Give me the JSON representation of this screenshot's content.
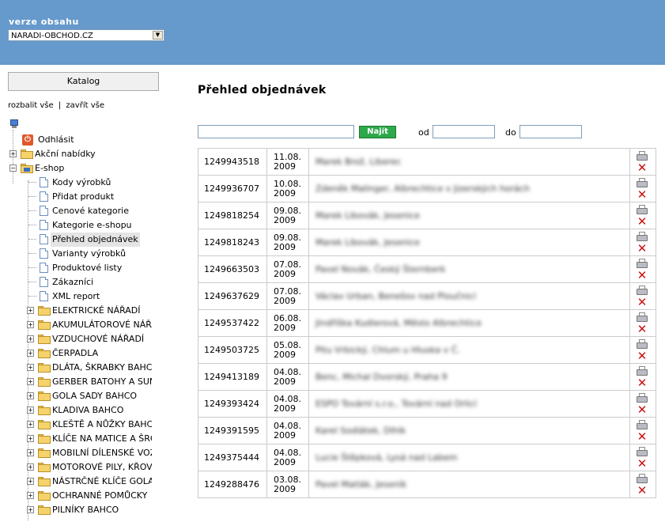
{
  "header": {
    "version_label": "verze obsahu",
    "version_selected": "NARADI-OBCHOD.CZ"
  },
  "sidebar": {
    "katalog_button": "Katalog",
    "expand_all": "rozbalit vše",
    "separator": "|",
    "collapse_all": "zavřít vše",
    "tree": [
      {
        "label": "Odhlásit",
        "icon": "logout-icon"
      },
      {
        "label": "Akční nabídky",
        "icon": "folder-icon"
      },
      {
        "label": "E-shop",
        "icon": "folder-open-icon"
      },
      {
        "label": "Kody výrobků",
        "icon": "page-icon"
      },
      {
        "label": "Přidat produkt",
        "icon": "page-icon"
      },
      {
        "label": "Cenové kategorie",
        "icon": "page-icon"
      },
      {
        "label": "Kategorie e-shopu",
        "icon": "page-icon"
      },
      {
        "label": "Přehled objednávek",
        "icon": "page-icon"
      },
      {
        "label": "Varianty výrobků",
        "icon": "page-icon"
      },
      {
        "label": "Produktové listy",
        "icon": "page-icon"
      },
      {
        "label": "Zákazníci",
        "icon": "page-icon"
      },
      {
        "label": "XML report",
        "icon": "page-icon"
      },
      {
        "label": "ELEKTRICKÉ NÁŘADÍ",
        "icon": "folder-icon"
      },
      {
        "label": "AKUMULÁTOROVÉ NÁŘADÍ",
        "icon": "folder-icon"
      },
      {
        "label": "VZDUCHOVÉ NÁŘADÍ",
        "icon": "folder-icon"
      },
      {
        "label": "ČERPADLA",
        "icon": "folder-icon"
      },
      {
        "label": "DLÁTA, ŠKRABKY BAHCO",
        "icon": "folder-icon"
      },
      {
        "label": "GERBER BATOHY A SUMKY",
        "icon": "folder-icon"
      },
      {
        "label": "GOLA SADY BAHCO",
        "icon": "folder-icon"
      },
      {
        "label": "KLADIVA BAHCO",
        "icon": "folder-icon"
      },
      {
        "label": "KLEŠTĚ A NŮŽKY BAHCO",
        "icon": "folder-icon"
      },
      {
        "label": "KLÍČE NA MATICE A ŠROUBY",
        "icon": "folder-icon"
      },
      {
        "label": "MOBILNÍ DÍLENSKÉ VOZÍKY",
        "icon": "folder-icon"
      },
      {
        "label": "MOTOROVÉ PILY, KŘOVINOŘEZY",
        "icon": "folder-icon"
      },
      {
        "label": "NÁSTRČNÉ KLÍČE GOLA",
        "icon": "folder-icon"
      },
      {
        "label": "OCHRANNÉ POMŮCKY",
        "icon": "folder-icon"
      },
      {
        "label": "PILNÍKY BAHCO",
        "icon": "folder-icon"
      }
    ]
  },
  "main": {
    "title": "Přehled objednávek",
    "search_button": "Najít",
    "from_label": "od",
    "to_label": "do",
    "orders": [
      {
        "id": "1249943518",
        "date": "11.08. 2009",
        "customer": "Marek Brož, Liberec"
      },
      {
        "id": "1249936707",
        "date": "10.08. 2009",
        "customer": "Zdeněk Malinger, Albrechtice v Jizerských horách"
      },
      {
        "id": "1249818254",
        "date": "09.08. 2009",
        "customer": "Marek Libovák, Jesenice"
      },
      {
        "id": "1249818243",
        "date": "09.08. 2009",
        "customer": "Marek Libovák, Jesenice"
      },
      {
        "id": "1249663503",
        "date": "07.08. 2009",
        "customer": "Pavel Novák, Český Šternberk"
      },
      {
        "id": "1249637629",
        "date": "07.08. 2009",
        "customer": "Václav Urban, Benešov nad Ploučnicí"
      },
      {
        "id": "1249537422",
        "date": "06.08. 2009",
        "customer": "Jindřiška Kudlerová, Město Albrechtice"
      },
      {
        "id": "1249503725",
        "date": "05.08. 2009",
        "customer": "Pitu Vrbický, Chlum u Hluska v Č."
      },
      {
        "id": "1249413189",
        "date": "04.08. 2009",
        "customer": "Benc, Michal Dvorský, Praha 9"
      },
      {
        "id": "1249393424",
        "date": "04.08. 2009",
        "customer": "ESPO Tovární s.r.o., Tovární nad Orlicí"
      },
      {
        "id": "1249391595",
        "date": "04.08. 2009",
        "customer": "Karel Sodlátek, Dlhlk"
      },
      {
        "id": "1249375444",
        "date": "04.08. 2009",
        "customer": "Lucie Štěpková, Lysá nad Labem"
      },
      {
        "id": "1249288476",
        "date": "03.08. 2009",
        "customer": "Pavel Matlák, Jeseník"
      }
    ]
  }
}
